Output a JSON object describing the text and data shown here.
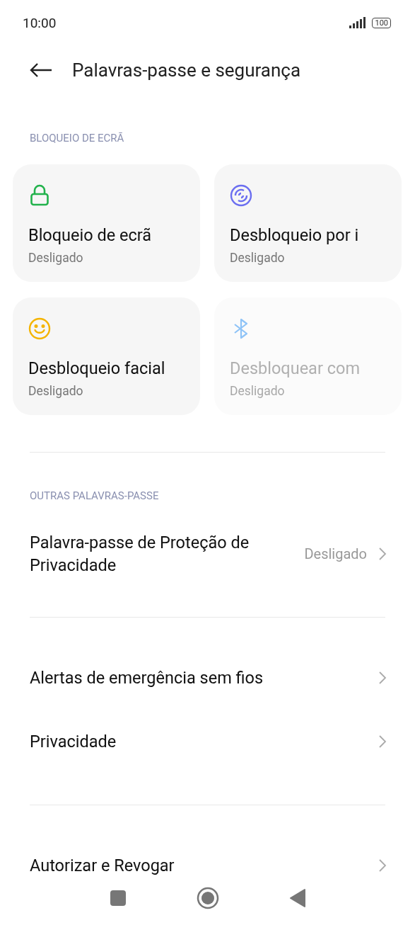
{
  "status_bar": {
    "time": "10:00",
    "battery": "100"
  },
  "header": {
    "title": "Palavras-passe e segurança"
  },
  "sections": [
    {
      "kind": "tiles",
      "label": "BLOQUEIO DE ECRÃ",
      "tiles": [
        {
          "kind": "lock",
          "color": "#22b24c",
          "title": "Bloqueio de ecrã",
          "status": "Desligado",
          "disabled": false
        },
        {
          "kind": "fingerprint",
          "color": "#6b6ef0",
          "title": "Desbloqueio por i",
          "status": "Desligado",
          "disabled": false
        },
        {
          "kind": "face",
          "color": "#f4b400",
          "title": "Desbloqueio facial",
          "status": "Desligado",
          "disabled": false
        },
        {
          "kind": "bluetooth",
          "color": "#8ec3f7",
          "title": "Desbloquear com",
          "status": "Desligado",
          "disabled": true
        }
      ]
    },
    {
      "kind": "rows",
      "label": "OUTRAS PALAVRAS-PASSE",
      "rows": [
        {
          "title": "Palavra-passe de Proteção de Privacidade",
          "value": "Desligado"
        }
      ]
    },
    {
      "kind": "rows",
      "rows": [
        {
          "title": "Alertas de emergência sem fios"
        },
        {
          "title": "Privacidade"
        }
      ]
    },
    {
      "kind": "rows",
      "rows": [
        {
          "title": "Autorizar e Revogar"
        }
      ]
    }
  ]
}
